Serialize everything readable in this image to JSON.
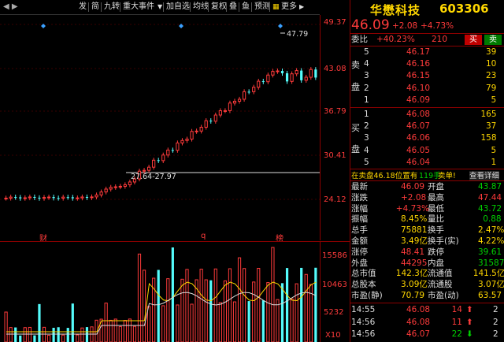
{
  "toolbar": {
    "items": [
      "发",
      "简",
      "九转",
      "重大事件",
      "加自选",
      "均线",
      "复权",
      "叠",
      "鱼",
      "预测",
      "更多"
    ],
    "dropdown_arrow": "▼",
    "more_arrow": "▶"
  },
  "left_arrows": "◀ ▶",
  "kline": {
    "y_labels": [
      "49.37",
      "43.08",
      "36.79",
      "30.41",
      "24.12"
    ],
    "high_label": "47.79",
    "range_label": "27.64-27.97",
    "markers": [
      "财",
      "q",
      "榜"
    ]
  },
  "volume": {
    "y_labels": [
      "15586",
      "10463",
      "5232",
      "X10"
    ]
  },
  "stock": {
    "name": "华懋科技",
    "code": "603306",
    "price": "46.09",
    "change": "+2.08",
    "change_pct": "+4.73%"
  },
  "weibi": {
    "label": "委比",
    "ratio": "+40.23%",
    "diff": "210",
    "btn_sell": "买",
    "btn_buy": "卖"
  },
  "sell_side_label": [
    "卖",
    "盘"
  ],
  "buy_side_label": [
    "买",
    "盘"
  ],
  "asks": [
    {
      "level": "5",
      "price": "46.17",
      "vol": "39"
    },
    {
      "level": "4",
      "price": "46.16",
      "vol": "10"
    },
    {
      "level": "3",
      "price": "46.15",
      "vol": "23"
    },
    {
      "level": "2",
      "price": "46.10",
      "vol": "79"
    },
    {
      "level": "1",
      "price": "46.09",
      "vol": "5"
    }
  ],
  "bids": [
    {
      "level": "1",
      "price": "46.08",
      "vol": "165"
    },
    {
      "level": "2",
      "price": "46.07",
      "vol": "37"
    },
    {
      "level": "3",
      "price": "46.06",
      "vol": "158"
    },
    {
      "level": "4",
      "price": "46.05",
      "vol": "5"
    },
    {
      "level": "5",
      "price": "46.04",
      "vol": "1"
    }
  ],
  "notice": {
    "prefix": "在卖盘46.18位置有",
    "amount": "119手",
    "suffix": "卖单!",
    "link": "查看详细"
  },
  "stats": [
    {
      "l1": "最新",
      "v1": "46.09",
      "c1": "red",
      "l2": "开盘",
      "v2": "43.87",
      "c2": "green"
    },
    {
      "l1": "涨跌",
      "v1": "+2.08",
      "c1": "red",
      "l2": "最高",
      "v2": "47.44",
      "c2": "red"
    },
    {
      "l1": "涨幅",
      "v1": "+4.73%",
      "c1": "red",
      "l2": "最低",
      "v2": "43.72",
      "c2": "green"
    },
    {
      "l1": "振幅",
      "v1": "8.45%",
      "c1": "yellow",
      "l2": "量比",
      "v2": "0.88",
      "c2": "green"
    },
    {
      "l1": "总手",
      "v1": "75881",
      "c1": "yellow",
      "l2": "换手",
      "v2": "2.47%",
      "c2": "yellow"
    },
    {
      "l1": "金额",
      "v1": "3.49亿",
      "c1": "yellow",
      "l2": "换手(实)",
      "v2": "4.22%",
      "c2": "yellow"
    },
    {
      "l1": "涨停",
      "v1": "48.41",
      "c1": "red",
      "l2": "跌停",
      "v2": "39.61",
      "c2": "green"
    },
    {
      "l1": "外盘",
      "v1": "44295",
      "c1": "red",
      "l2": "内盘",
      "v2": "31587",
      "c2": "green"
    },
    {
      "l1": "总市值",
      "v1": "142.3亿",
      "c1": "yellow",
      "l2": "流通值",
      "v2": "141.5亿",
      "c2": "yellow"
    },
    {
      "l1": "总股本",
      "v1": "3.09亿",
      "c1": "yellow",
      "l2": "流通股",
      "v2": "3.07亿",
      "c2": "yellow"
    },
    {
      "l1": "市盈(静)",
      "v1": "70.79",
      "c1": "yellow",
      "l2": "市盈(动)",
      "v2": "63.57",
      "c2": "yellow"
    }
  ],
  "ticks": [
    {
      "time": "14:55",
      "price": "46.08",
      "vol": "14",
      "dir": "up",
      "n": "2"
    },
    {
      "time": "14:56",
      "price": "46.08",
      "vol": "11",
      "dir": "up",
      "n": "2"
    },
    {
      "time": "14:56",
      "price": "46.07",
      "vol": "22",
      "dir": "down",
      "n": "2"
    }
  ],
  "colors": {
    "up": "#ff3b3b",
    "down": "#00d200",
    "cyan": "#54fcfc",
    "yellow": "#ffd700"
  }
}
